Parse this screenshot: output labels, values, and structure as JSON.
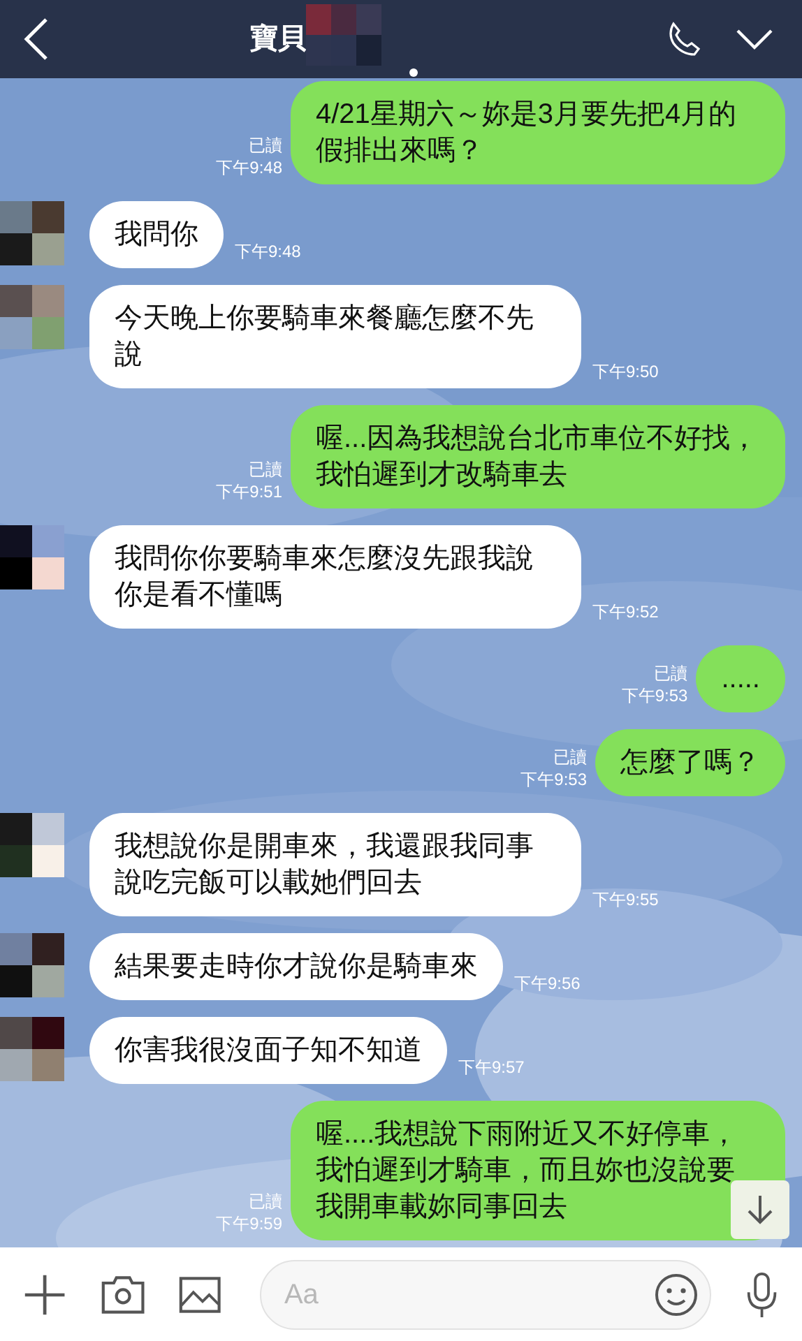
{
  "header": {
    "title": "寶貝"
  },
  "messages": [
    {
      "kind": "sent",
      "text": "4/21星期六～妳是3月要先把4月的假排出來嗎？",
      "read": "已讀",
      "time": "下午9:48"
    },
    {
      "kind": "received",
      "text": "我問你",
      "time": "下午9:48"
    },
    {
      "kind": "received",
      "text": "今天晚上你要騎車來餐廳怎麼不先說",
      "time": "下午9:50"
    },
    {
      "kind": "sent",
      "text": "喔...因為我想說台北市車位不好找，我怕遲到才改騎車去",
      "read": "已讀",
      "time": "下午9:51"
    },
    {
      "kind": "received",
      "text": "我問你你要騎車來怎麼沒先跟我說你是看不懂嗎",
      "time": "下午9:52"
    },
    {
      "kind": "sent",
      "text": ".....",
      "read": "已讀",
      "time": "下午9:53"
    },
    {
      "kind": "sent",
      "text": "怎麼了嗎？",
      "read": "已讀",
      "time": "下午9:53"
    },
    {
      "kind": "received",
      "text": "我想說你是開車來，我還跟我同事說吃完飯可以載她們回去",
      "time": "下午9:55"
    },
    {
      "kind": "received",
      "text": "結果要走時你才說你是騎車來",
      "time": "下午9:56"
    },
    {
      "kind": "received",
      "text": "你害我很沒面子知不知道",
      "time": "下午9:57"
    },
    {
      "kind": "sent",
      "text": "喔....我想說下雨附近又不好停車，我怕遲到才騎車，而且妳也沒說要我開車載妳同事回去",
      "read": "已讀",
      "time": "下午9:59"
    }
  ],
  "input": {
    "placeholder": "Aa"
  }
}
